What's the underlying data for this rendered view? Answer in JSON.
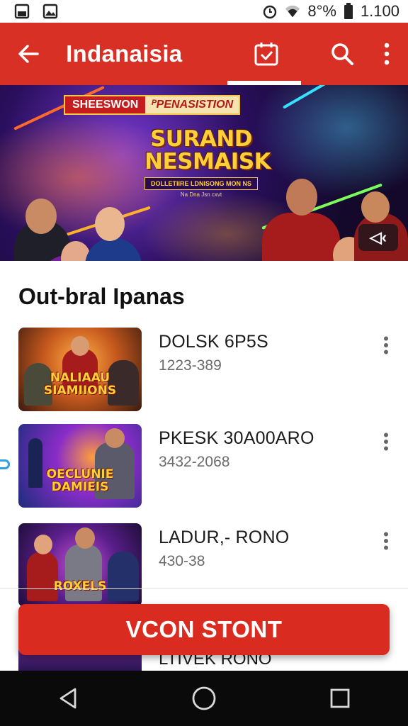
{
  "status_bar": {
    "battery": "8°%",
    "time": "1.100",
    "icons": [
      "gallery-icon",
      "image-icon",
      "alarm-icon",
      "wifi-icon",
      "battery-icon"
    ]
  },
  "app_bar": {
    "title": "Indanaisia",
    "icons": [
      "back-arrow-icon",
      "calendar-check-icon",
      "search-icon",
      "more-vert-icon"
    ],
    "accent": "#d93025"
  },
  "banner": {
    "tag_left": "SHEESWON",
    "tag_right": "ᴾPENASISTION",
    "logo_line1": "SURAND",
    "logo_line2": "NESMAISK",
    "logo_sub": "DOLLETIIRE LDNISONG MON NS",
    "logo_sub2": "Na Dna Jsn cxvt",
    "button_label": "◁‹"
  },
  "section": {
    "title": "Out-bral Ipanas"
  },
  "list": [
    {
      "name": "DOLSK 6P5S",
      "meta": "1223-389",
      "thumb_title": "NALIAAU SIAMIIONS"
    },
    {
      "name": "PKESK 30A00ARO",
      "meta": "3432-2068",
      "thumb_title": "OECLUNIE DAMIEIS"
    },
    {
      "name": "LADUR,- RONO",
      "meta": "430-38",
      "thumb_title": "ROXELS"
    }
  ],
  "peek_item": {
    "name": "LTIVEK RONO"
  },
  "cta": {
    "label": "VCON STONT",
    "color": "#d92b20"
  },
  "nav": {
    "icons": [
      "nav-back-icon",
      "nav-home-icon",
      "nav-recents-icon"
    ]
  }
}
